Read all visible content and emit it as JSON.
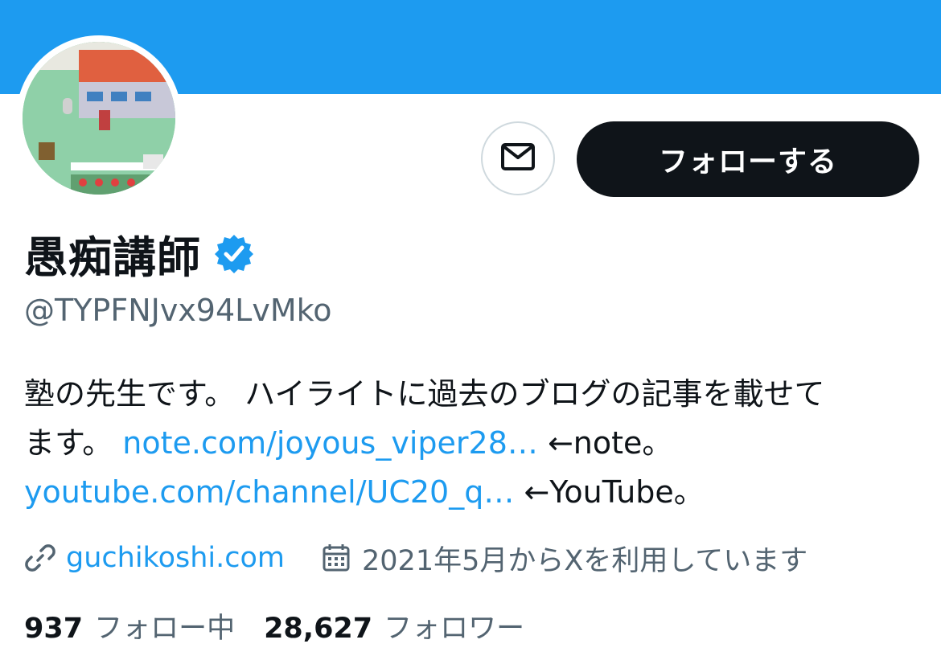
{
  "colors": {
    "banner": "#1d9bf0",
    "link": "#1d9bf0",
    "follow_button_bg": "#0f1419",
    "secondary_text": "#536471"
  },
  "profile": {
    "display_name": "愚痴講師",
    "verified_icon": "verified-badge-icon",
    "handle": "@TYPFNJvx94LvMko",
    "follow_label": "フォローする",
    "message_icon": "mail-icon"
  },
  "bio": {
    "line1": "塾の先生です。 ハイライトに過去のブログの記事を載せて",
    "line2_prefix": "ます。 ",
    "note_link": "note.com/joyous_viper28…",
    "note_suffix": " ←note。",
    "youtube_link": "youtube.com/channel/UC20_q…",
    "youtube_suffix": " ←YouTube。"
  },
  "meta": {
    "website": "guchikoshi.com",
    "joined": "2021年5月からXを利用しています"
  },
  "stats": {
    "following_count": "937",
    "following_label": "フォロー中",
    "followers_count": "28,627",
    "followers_label": "フォロワー"
  }
}
